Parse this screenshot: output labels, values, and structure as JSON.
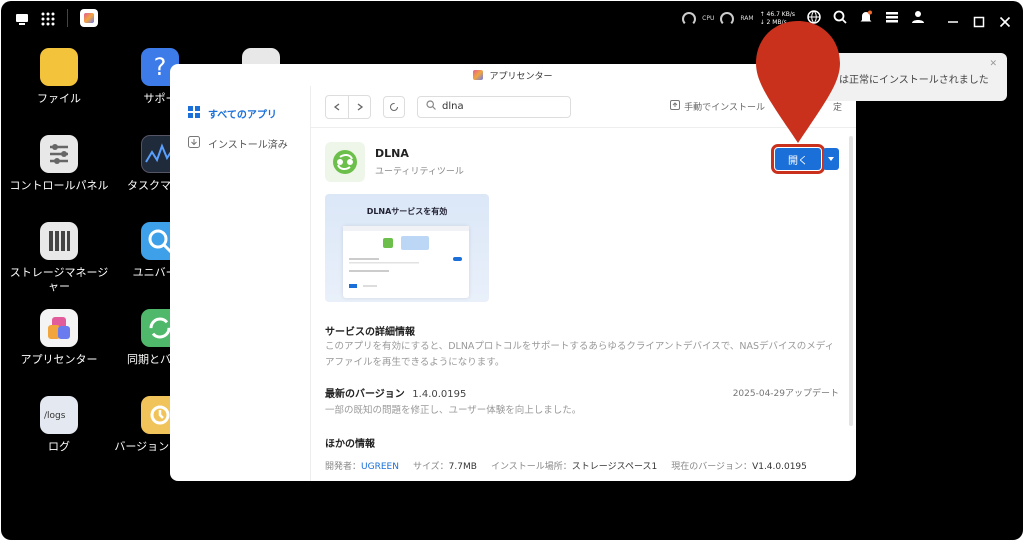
{
  "window": {
    "title": "アプリセンター"
  },
  "sidebar": {
    "items": [
      {
        "label": "すべてのアプリ",
        "icon": "grid-icon",
        "active": true
      },
      {
        "label": "インストール済み",
        "icon": "download-icon",
        "active": false
      }
    ]
  },
  "toolbar": {
    "search_value": "dlna",
    "manual_install": "手動でインストール",
    "settings_fragment": "定"
  },
  "app": {
    "name": "DLNA",
    "category": "ユーティリティツール",
    "open_label": "開く",
    "screenshot_title": "DLNAサービスを有効"
  },
  "details": {
    "title": "サービスの詳細情報",
    "text": "このアプリを有効にすると、DLNAプロトコルをサポートするあらゆるクライアントデバイスで、NASデバイスのメディアファイルを再生できるようになります。"
  },
  "version": {
    "title": "最新のバージョン",
    "number": "1.4.0.0195",
    "date": "2025-04-29アップデート",
    "notes": "一部の既知の問題を修正し、ユーザー体験を向上しました。"
  },
  "other": {
    "title": "ほかの情報",
    "developer_label": "開発者：",
    "developer": "UGREEN",
    "size_label": "サイズ：",
    "size": "7.7MB",
    "location_label": "インストール場所：",
    "location": "ストレージスペース1",
    "current_label": "現在のバージョン：",
    "current": "V1.4.0.0195"
  },
  "toast": {
    "text": "は正常にインストールされました"
  },
  "topbar": {
    "up_speed": "↑ 46.7 KB/s",
    "down_speed": "↓ 2 MB/s",
    "cpu_label": "CPU",
    "ram_label": "RAM"
  },
  "desktop": {
    "icons": [
      {
        "label": "ファイル"
      },
      {
        "label": "サポー"
      },
      {
        "label": "コントロールパネル"
      },
      {
        "label": "タスクマネー"
      },
      {
        "label": "ストレージマネージャー"
      },
      {
        "label": "ユニバーサ"
      },
      {
        "label": "アプリセンター"
      },
      {
        "label": "同期とバック"
      },
      {
        "label": "ログ"
      },
      {
        "label": "バージョンマ ャー"
      }
    ],
    "logs_glyph_text": "/logs"
  },
  "colors": {
    "accent": "#1a6fd8",
    "highlight": "#c9311c"
  }
}
